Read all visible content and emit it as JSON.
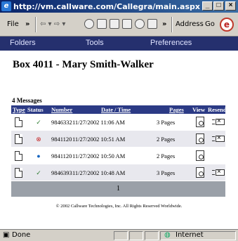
{
  "window": {
    "title": "http://vm.callware.com/Callegra/main.aspx - Microsoft In...",
    "minimize_glyph": "_",
    "maximize_glyph": "□",
    "close_glyph": "×"
  },
  "toolbar": {
    "file_label": "File",
    "chevron_label": "»",
    "nav_glyphs": "⇦ ▾ ⇨ ▾",
    "address_chevron": "»",
    "address_label": "Address",
    "go_label": "Go"
  },
  "nav": {
    "items": [
      "Folders",
      "Tools",
      "Preferences"
    ]
  },
  "page": {
    "title": "Box 4011 - Mary Smith-Walker",
    "message_count": "4 Messages"
  },
  "table": {
    "headers": [
      "Type",
      "Status",
      "Number",
      "Date / Time",
      "Pages",
      "View",
      "Resend"
    ],
    "rows": [
      {
        "status": "read",
        "status_glyph": "✓",
        "number": "9846332",
        "datetime": "11/27/2002 11:06 AM",
        "pages": "3 Pages",
        "resend": true
      },
      {
        "status": "failed",
        "status_glyph": "⊗",
        "number": "9841120",
        "datetime": "11/27/2002 10:51 AM",
        "pages": "2 Pages",
        "resend": true
      },
      {
        "status": "new",
        "status_glyph": "●",
        "number": "9841120",
        "datetime": "11/27/2002 10:50 AM",
        "pages": "2 Pages",
        "resend": false
      },
      {
        "status": "read",
        "status_glyph": "✓",
        "number": "9846393",
        "datetime": "11/27/2002 10:48 AM",
        "pages": "3 Pages",
        "resend": true
      }
    ],
    "pager": "1"
  },
  "footer": {
    "copyright": "© 2002 Callware Technologies, Inc. All Rights Reserved Worldwide."
  },
  "statusbar": {
    "left_text": "Done",
    "zone_text": "Internet"
  },
  "colors": {
    "navbar": "#25306e",
    "table_header": "#2b3a85",
    "pager": "#9aa0a8",
    "status_read": "#2e7d32",
    "status_failed": "#c62828",
    "status_new": "#1565c0"
  }
}
